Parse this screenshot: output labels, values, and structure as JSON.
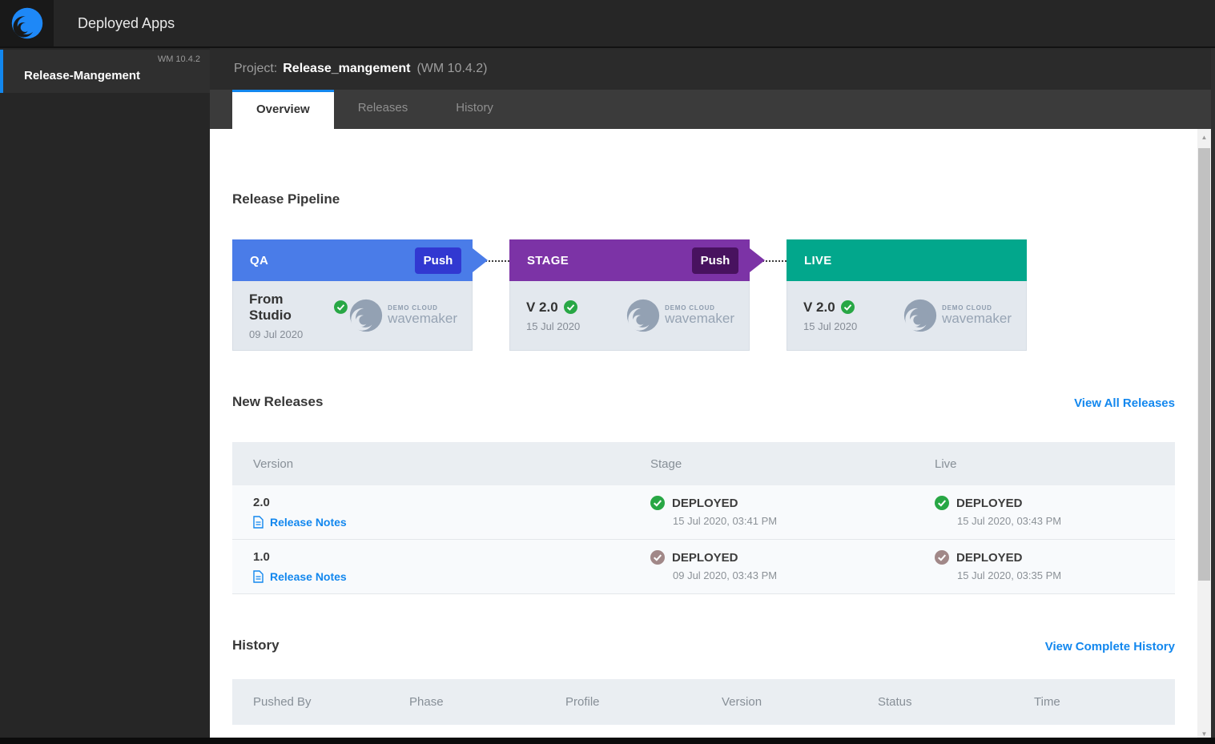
{
  "topbar": {
    "title": "Deployed Apps"
  },
  "sidebar": {
    "item": {
      "name": "Release-Mangement",
      "version": "WM 10.4.2"
    }
  },
  "project_header": {
    "label": "Project:",
    "name": "Release_mangement",
    "version": "(WM 10.4.2)"
  },
  "tabs": [
    {
      "label": "Overview",
      "active": true
    },
    {
      "label": "Releases",
      "active": false
    },
    {
      "label": "History",
      "active": false
    }
  ],
  "pipeline": {
    "heading": "Release Pipeline",
    "stages": [
      {
        "name": "QA",
        "push_label": "Push",
        "version": "From Studio",
        "date": "09 Jul 2020"
      },
      {
        "name": "STAGE",
        "push_label": "Push",
        "version": "V 2.0",
        "date": "15 Jul 2020"
      },
      {
        "name": "LIVE",
        "version": "V 2.0",
        "date": "15 Jul 2020"
      }
    ],
    "cloud_logo": {
      "line1": "DEMO CLOUD",
      "line2": "wavemaker"
    }
  },
  "new_releases": {
    "heading": "New Releases",
    "view_all_label": "View All Releases",
    "columns": {
      "version": "Version",
      "stage": "Stage",
      "live": "Live"
    },
    "rows": [
      {
        "version": "2.0",
        "notes_label": "Release Notes",
        "stage": {
          "status": "DEPLOYED",
          "time": "15 Jul 2020, 03:41 PM",
          "check": "green"
        },
        "live": {
          "status": "DEPLOYED",
          "time": "15 Jul 2020, 03:43 PM",
          "check": "green"
        }
      },
      {
        "version": "1.0",
        "notes_label": "Release Notes",
        "stage": {
          "status": "DEPLOYED",
          "time": "09 Jul 2020, 03:43 PM",
          "check": "brown"
        },
        "live": {
          "status": "DEPLOYED",
          "time": "15 Jul 2020, 03:35 PM",
          "check": "brown"
        }
      }
    ]
  },
  "history": {
    "heading": "History",
    "view_all_label": "View Complete History",
    "columns": [
      "Pushed By",
      "Phase",
      "Profile",
      "Version",
      "Status",
      "Time"
    ]
  },
  "colors": {
    "accent_blue": "#1287ee",
    "qa_header": "#4a7ce8",
    "qa_push": "#3138d1",
    "stage_header": "#7c33a6",
    "stage_push": "#48125f",
    "live_header": "#02a78c",
    "check_green": "#28a745",
    "check_old": "#a18888",
    "topbar_bg": "#262626",
    "card_body_bg": "#e3e8ee",
    "table_header_bg": "#eaeef2"
  }
}
